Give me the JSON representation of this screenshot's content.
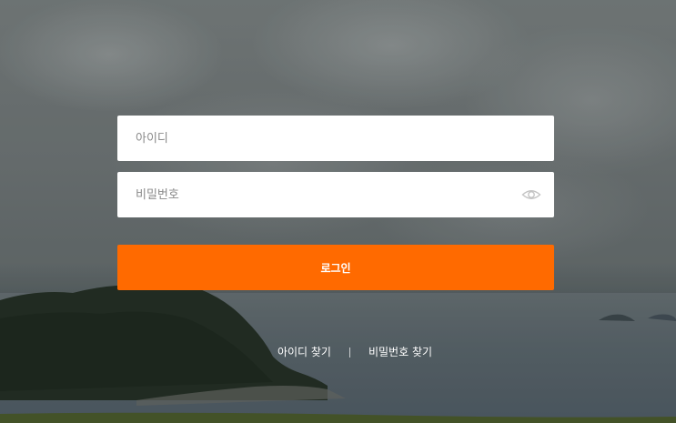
{
  "login_form": {
    "id_placeholder": "아이디",
    "password_placeholder": "비밀번호",
    "login_label": "로그인",
    "show_password_icon": "eye-icon"
  },
  "links": {
    "find_id": "아이디 찾기",
    "find_password": "비밀번호 찾기"
  },
  "colors": {
    "accent": "#ff6a00",
    "field_background": "#ffffff"
  }
}
